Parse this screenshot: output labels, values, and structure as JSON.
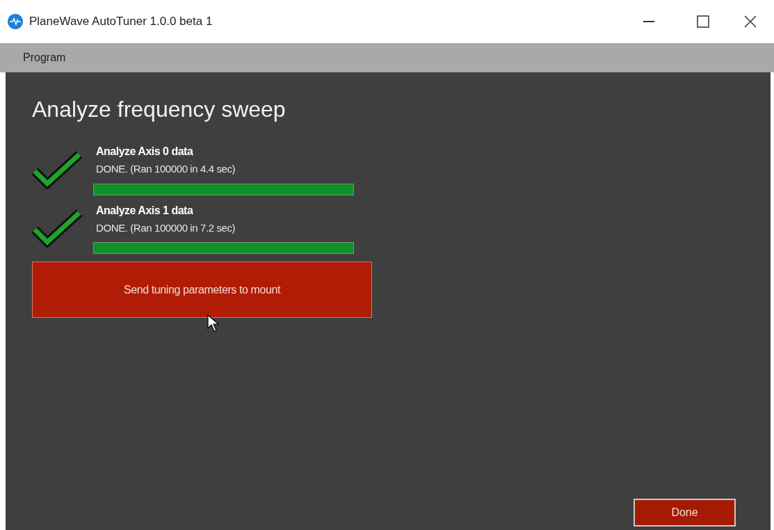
{
  "window": {
    "title": "PlaneWave AutoTuner 1.0.0 beta 1"
  },
  "menu": [
    "Program"
  ],
  "heading": "Analyze frequency sweep",
  "tasks": [
    {
      "title": "Analyze Axis 0 data",
      "status": "DONE. (Ran 100000 in 4.4 sec)",
      "done": true,
      "level": 1
    },
    {
      "title": "Analyze Axis 1 data",
      "status": "DONE. (Ran 100000 in 7.2 sec)",
      "done": true,
      "level": 1
    }
  ],
  "send_button": "Send tuning parameters to mount",
  "done_button": "Done"
}
